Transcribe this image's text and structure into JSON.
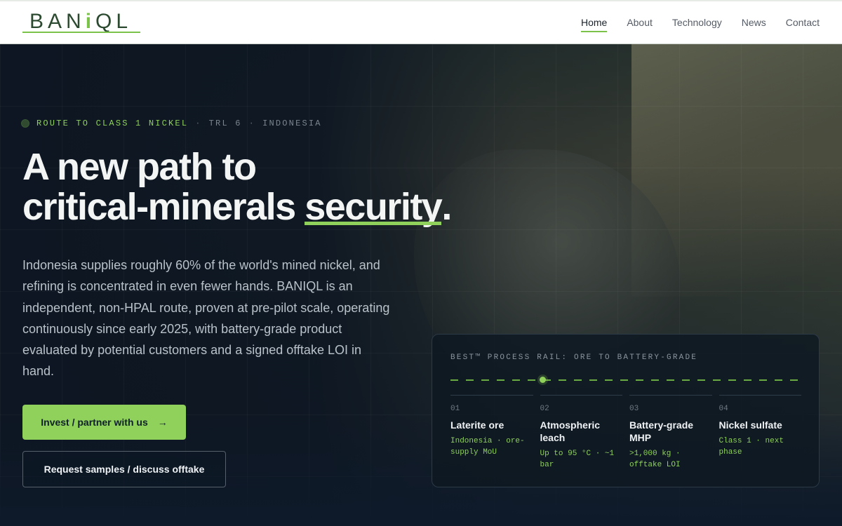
{
  "brand": {
    "name_part1": "BA",
    "name_part2": "N",
    "name_part3": "i",
    "name_part4": "QL"
  },
  "nav": {
    "items": [
      {
        "label": "Home",
        "active": true
      },
      {
        "label": "About"
      },
      {
        "label": "Technology"
      },
      {
        "label": "News"
      },
      {
        "label": "Contact"
      }
    ]
  },
  "hero": {
    "eyebrow": {
      "main": "ROUTE TO CLASS 1 NICKEL",
      "sep1": "·",
      "trl": "TRL 6",
      "sep2": "·",
      "location": "INDONESIA"
    },
    "headline": {
      "line1": "A new path to",
      "line2_pre": "critical-minerals ",
      "line2_underlined": "security",
      "line2_post": "."
    },
    "lead": "Indonesia supplies roughly 60% of the world's mined nickel, and refining is concentrated in even fewer hands. BANIQL is an independent, non-HPAL route, proven at pre-pilot scale, operating continuously since early 2025, with battery-grade product evaluated by potential customers and a signed offtake LOI in hand.",
    "cta_primary": {
      "label": "Invest / partner with us",
      "arrow": "→"
    },
    "cta_secondary": {
      "label": "Request samples / discuss offtake"
    }
  },
  "process_rail": {
    "title": "BEST™ PROCESS RAIL: ORE TO BATTERY-GRADE",
    "active_step": 2,
    "steps": [
      {
        "num": "01",
        "title": "Laterite ore",
        "detail": "Indonesia · ore-supply MoU"
      },
      {
        "num": "02",
        "title": "Atmospheric leach",
        "detail": "Up to 95 °C · ~1 bar"
      },
      {
        "num": "03",
        "title": "Battery-grade MHP",
        "detail": ">1,000 kg · offtake LOI"
      },
      {
        "num": "04",
        "title": "Nickel sulfate",
        "detail": "Class 1 · next phase"
      }
    ]
  },
  "colors": {
    "accent": "#8fd15a",
    "brand_dark": "#2c4a30",
    "background": "#0d1622"
  }
}
